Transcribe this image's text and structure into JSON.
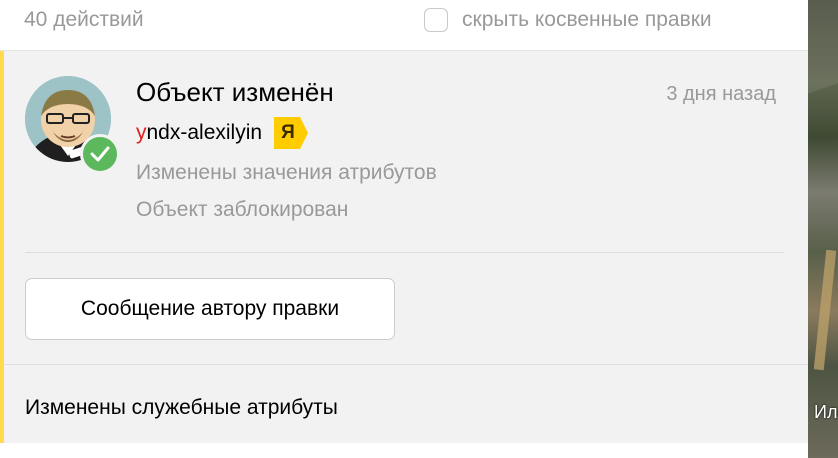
{
  "history": {
    "count_label": "40 действий",
    "hide_indirect_label": "скрыть косвенные правки"
  },
  "edit": {
    "title": "Объект изменён",
    "time_ago": "3 дня назад",
    "author": {
      "name_first_letter": "y",
      "name_rest": "ndx-alexilyin",
      "badge": "Я",
      "avatar_icon": "cartoon-avatar-icon",
      "verified_icon": "check-circle-icon"
    },
    "details": [
      "Изменены значения атрибутов",
      "Объект заблокирован"
    ],
    "message_button_label": "Сообщение автору правки",
    "service_attributes_label": "Изменены служебные атрибуты"
  },
  "map": {
    "partial_label": "Иле"
  },
  "colors": {
    "accent_yellow": "#ffdb4d",
    "verified_green": "#5cb85c",
    "muted_text": "#999999",
    "card_bg": "#f2f2f2",
    "username_first_letter": "#e02020"
  }
}
